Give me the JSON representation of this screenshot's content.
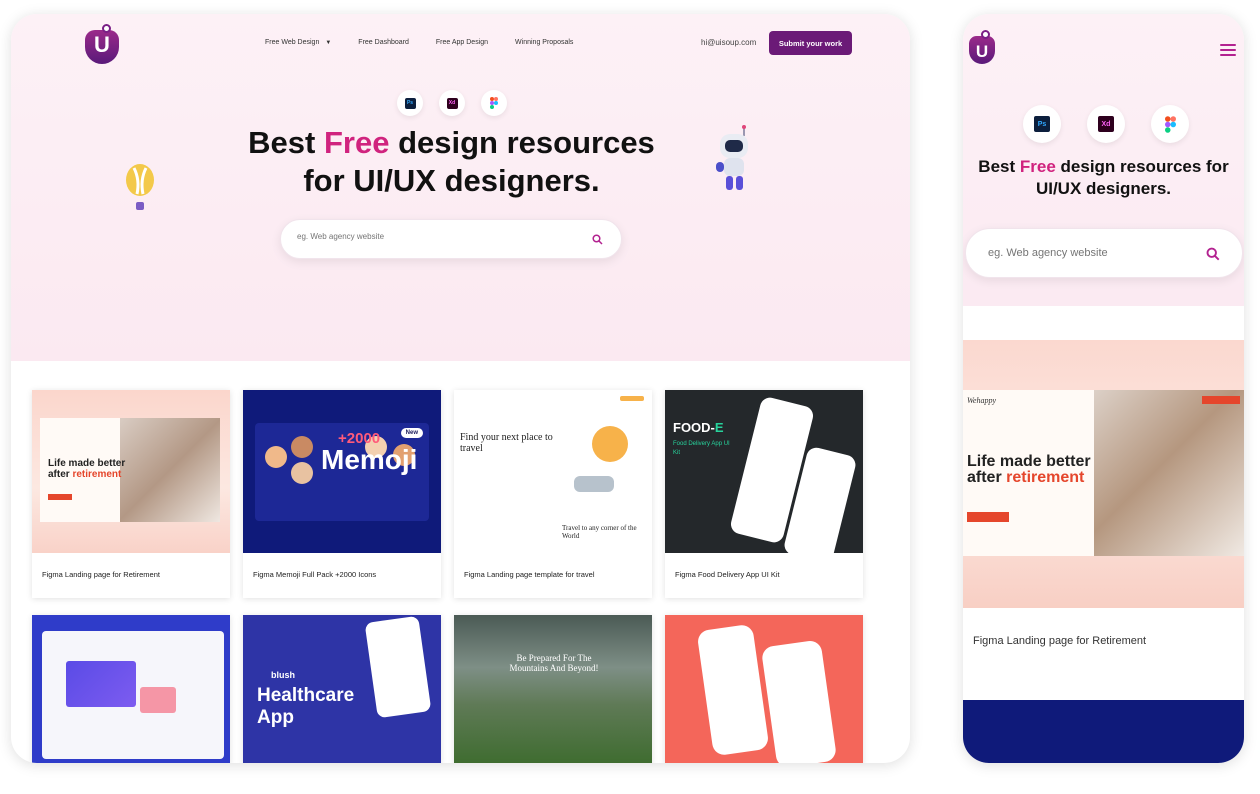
{
  "nav": {
    "logo_letter": "U",
    "menu": [
      "Free Web Design",
      "Free Dashboard",
      "Free App Design",
      "Winning Proposals"
    ],
    "email": "hi@uisoup.com",
    "submit_label": "Submit your work"
  },
  "tools": {
    "ps": "Ps",
    "xd": "Xd"
  },
  "hero": {
    "headline_pre": "Best ",
    "headline_accent": "Free",
    "headline_post": " design resources",
    "headline_line2": "for UI/UX designers.",
    "search_placeholder": "eg. Web agency website"
  },
  "cards": [
    {
      "caption": "Figma Landing page for Retirement"
    },
    {
      "caption": "Figma Memoji Full Pack +2000 Icons"
    },
    {
      "caption": "Figma Landing page template for travel"
    },
    {
      "caption": "Figma Food Delivery App UI Kit"
    }
  ],
  "thumbs": {
    "retire_heading_1": "Life made better after ",
    "retire_heading_accent": "retirement",
    "memoji_new": "New",
    "memoji_count": "+2000",
    "memoji_title": "Memoji",
    "travel_heading": "Find your next place to travel",
    "travel_sub": "Travel to any corner of the World",
    "food_title_1": "FOOD-",
    "food_title_2": "E",
    "food_sub": "Food Delivery App UI Kit",
    "health_brand": "blush",
    "health_title": "Healthcare App",
    "mountain_title": "Be Prepared For The Mountains And Beyond!"
  },
  "mobile": {
    "headline_pre": "Best ",
    "headline_accent": "Free",
    "headline_post": " design resources for UI/UX designers.",
    "search_placeholder": "eg. Web agency website",
    "shot_brand": "Wehappy",
    "shot_heading_1": "Life made better after ",
    "shot_heading_accent": "retirement",
    "caption": "Figma Landing page for Retirement"
  },
  "colors": {
    "brand": "#6b1a77",
    "accent": "#d0237e",
    "hero_bg": "#fdf1f6"
  }
}
